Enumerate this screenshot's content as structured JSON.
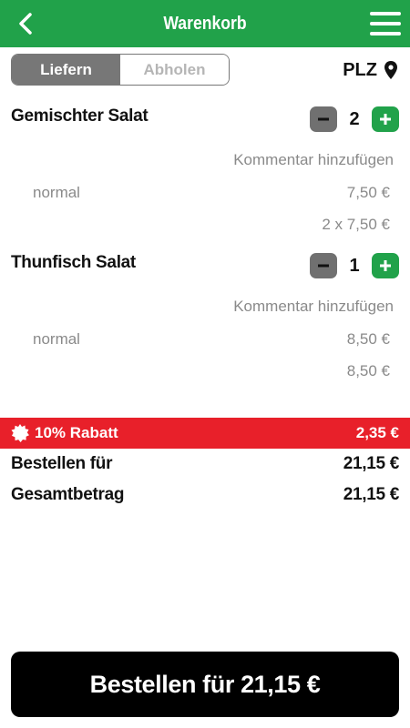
{
  "header": {
    "title": "Warenkorb",
    "back_icon": "chevron-left-icon",
    "menu_icon": "hamburger-menu-icon"
  },
  "delivery_toggle": {
    "options": [
      "Liefern",
      "Abholen"
    ],
    "selected": "Liefern"
  },
  "plz": {
    "label": "PLZ",
    "icon": "location-pin-icon"
  },
  "items": [
    {
      "name": "Gemischter Salat",
      "quantity": "2",
      "comment_link": "Kommentar hinzufügen",
      "variant": "normal",
      "unit_price": "7,50 €",
      "total": "2 x 7,50 €"
    },
    {
      "name": "Thunfisch Salat",
      "quantity": "1",
      "comment_link": "Kommentar hinzufügen",
      "variant": "normal",
      "unit_price": "8,50 €",
      "total": "8,50 €"
    }
  ],
  "discount": {
    "label": "10% Rabatt",
    "amount": "2,35 €",
    "icon": "discount-burst-icon"
  },
  "summary": {
    "order_for_label": "Bestellen für",
    "order_for_value": "21,15 €",
    "total_label": "Gesamtbetrag",
    "total_value": "21,15 €"
  },
  "order_button": {
    "label": "Bestellen für 21,15 €"
  },
  "colors": {
    "primary_green": "#21a24a",
    "discount_red": "#e8202a",
    "stepper_gray": "#707070",
    "button_black": "#000000"
  }
}
